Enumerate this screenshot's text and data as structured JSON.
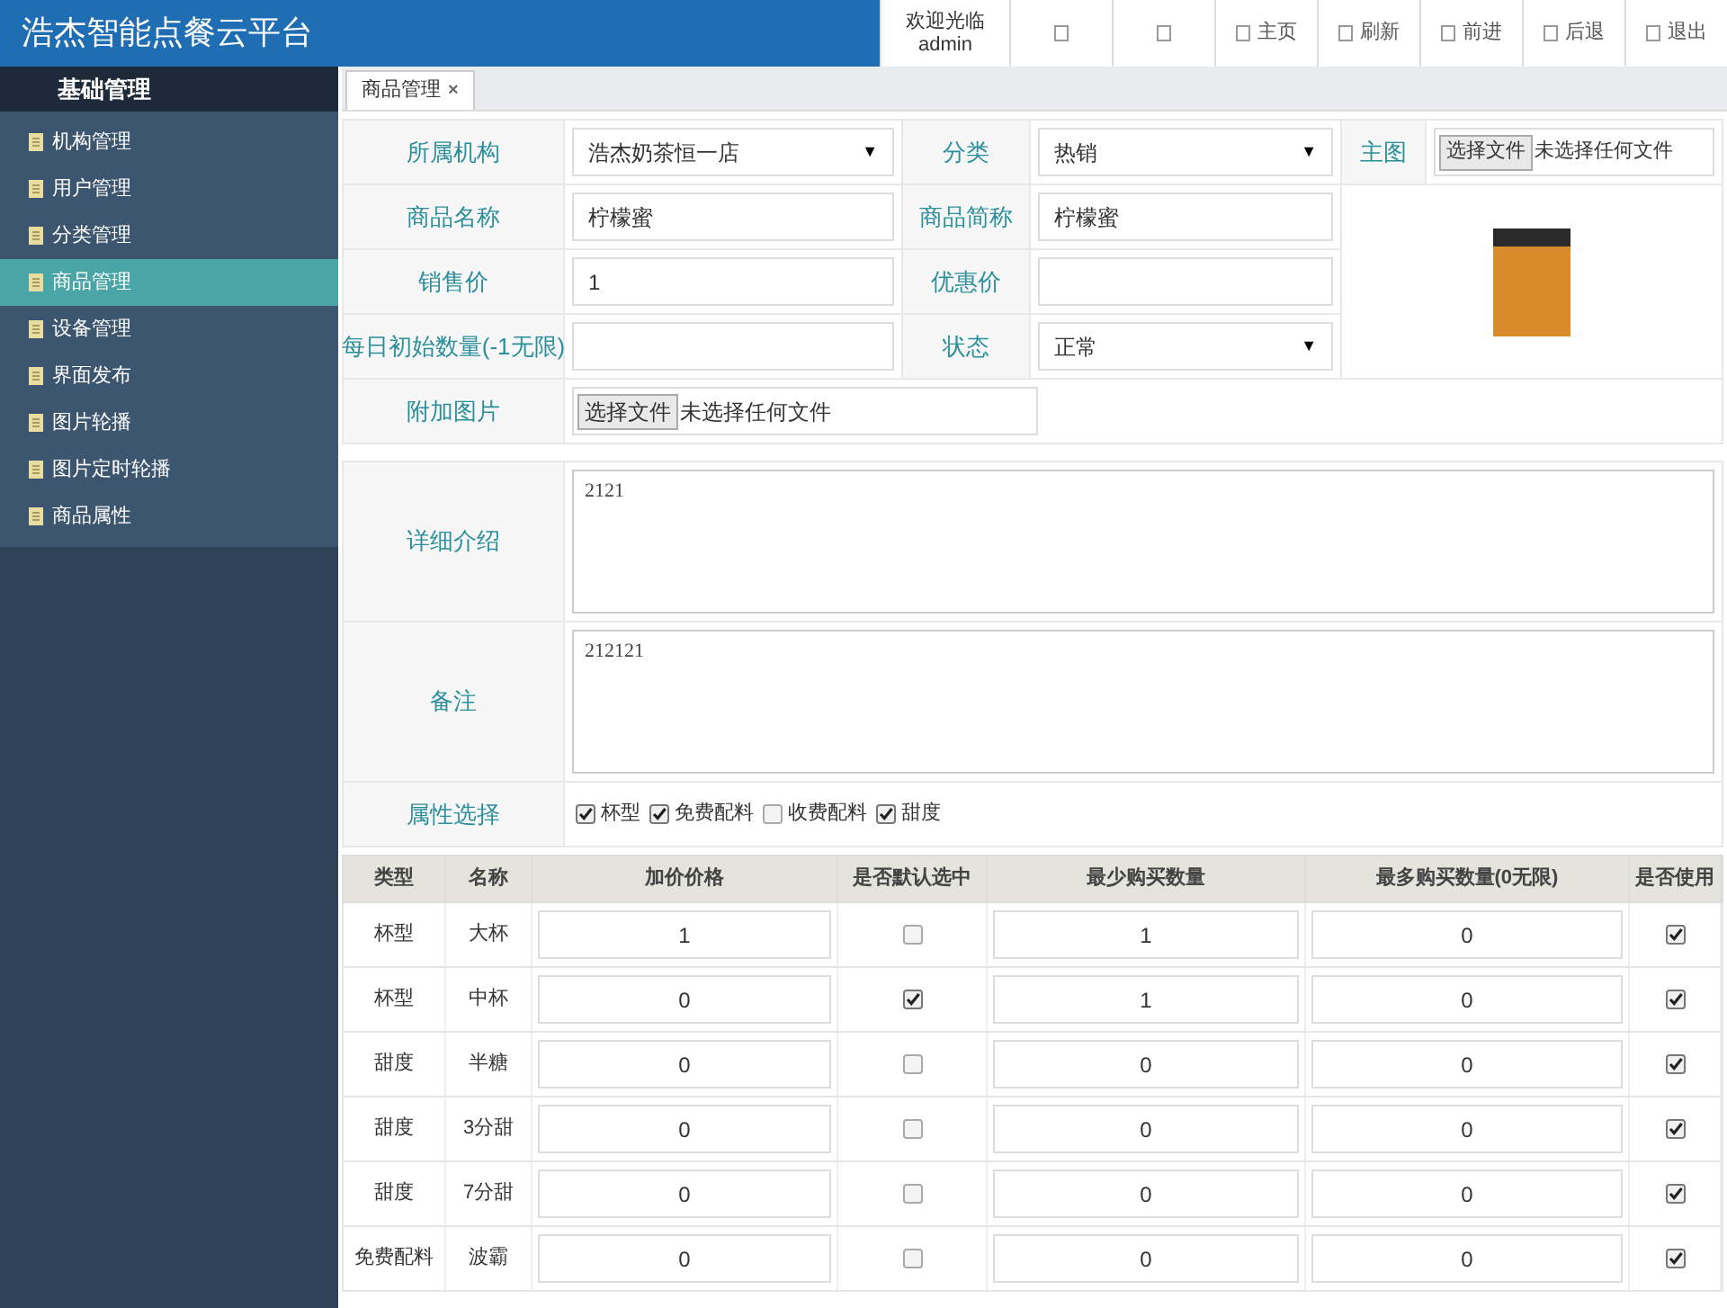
{
  "app_title": "浩杰智能点餐云平台",
  "header": {
    "welcome": "欢迎光临",
    "user": "admin",
    "nav": [
      {
        "kind": "icon"
      },
      {
        "kind": "icon"
      },
      {
        "kind": "labeled",
        "label": "主页"
      },
      {
        "kind": "labeled",
        "label": "刷新"
      },
      {
        "kind": "labeled",
        "label": "前进"
      },
      {
        "kind": "labeled",
        "label": "后退"
      },
      {
        "kind": "labeled",
        "label": "退出"
      }
    ]
  },
  "sidebar": {
    "heading": "基础管理",
    "items": [
      {
        "label": "机构管理",
        "selected": false
      },
      {
        "label": "用户管理",
        "selected": false
      },
      {
        "label": "分类管理",
        "selected": false
      },
      {
        "label": "商品管理",
        "selected": true
      },
      {
        "label": "设备管理",
        "selected": false
      },
      {
        "label": "界面发布",
        "selected": false
      },
      {
        "label": "图片轮播",
        "selected": false
      },
      {
        "label": "图片定时轮播",
        "selected": false
      },
      {
        "label": "商品属性",
        "selected": false
      }
    ]
  },
  "tabs": [
    {
      "label": "商品管理",
      "selected": true,
      "close": "×"
    }
  ],
  "form": {
    "fields": [
      {
        "label": "所属机构",
        "kind": "select",
        "value": "浩杰奶茶恒一店",
        "caret": "▼"
      },
      {
        "label": "分类",
        "kind": "select",
        "value": "热销",
        "caret": "▼"
      },
      {
        "label": "主图",
        "kind": "file",
        "button": "选择文件",
        "status": "未选择任何文件"
      },
      {
        "label": "商品名称",
        "kind": "text",
        "value": "柠檬蜜"
      },
      {
        "label": "商品简称",
        "kind": "text",
        "value": "柠檬蜜"
      },
      {
        "label": "销售价",
        "kind": "text",
        "value": "1"
      },
      {
        "label": "优惠价",
        "kind": "text"
      },
      {
        "label": "每日初始数量(-1无限)",
        "kind": "text"
      },
      {
        "label": "状态",
        "kind": "select",
        "value": "正常",
        "caret": "▼"
      },
      {
        "label": "附加图片",
        "kind": "file",
        "button": "选择文件",
        "status": "未选择任何文件"
      }
    ],
    "details": {
      "label": "详细介绍",
      "value": "2121"
    },
    "notes": {
      "label": "备注",
      "value": "212121"
    },
    "attributes": {
      "label": "属性选择",
      "options": [
        {
          "label": "杯型",
          "checked": true
        },
        {
          "label": "免费配料",
          "checked": true
        },
        {
          "label": "收费配料",
          "checked": false
        },
        {
          "label": "甜度",
          "checked": true
        }
      ]
    }
  },
  "table": {
    "columns": [
      "类型",
      "名称",
      "加价价格",
      "是否默认选中",
      "最少购买数量",
      "最多购买数量(0无限)",
      "是否使用"
    ],
    "rows": [
      {
        "type": "杯型",
        "name": "大杯",
        "price": "1",
        "default": false,
        "min": "1",
        "max": "0",
        "used": true
      },
      {
        "type": "杯型",
        "name": "中杯",
        "price": "0",
        "default": true,
        "min": "1",
        "max": "0",
        "used": true
      },
      {
        "type": "甜度",
        "name": "半糖",
        "price": "0",
        "default": false,
        "min": "0",
        "max": "0",
        "used": true
      },
      {
        "type": "甜度",
        "name": "3分甜",
        "price": "0",
        "default": false,
        "min": "0",
        "max": "0",
        "used": true
      },
      {
        "type": "甜度",
        "name": "7分甜",
        "price": "0",
        "default": false,
        "min": "0",
        "max": "0",
        "used": true
      },
      {
        "type": "免费配料",
        "name": "波霸",
        "price": "0",
        "default": false,
        "min": "0",
        "max": "0",
        "used": true
      }
    ]
  }
}
